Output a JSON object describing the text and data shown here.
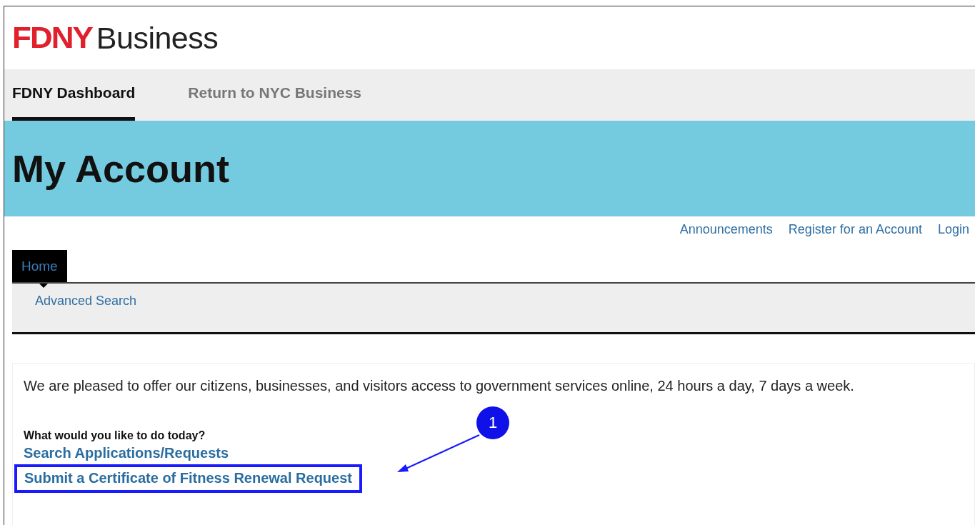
{
  "logo": {
    "mark": "FDNY",
    "word": "Business"
  },
  "nav_tabs": [
    {
      "label": "FDNY Dashboard",
      "selected": true
    },
    {
      "label": "Return to NYC Business",
      "selected": false
    }
  ],
  "banner": {
    "title": "My Account"
  },
  "utility_links": [
    "Announcements",
    "Register for an Account",
    "Login"
  ],
  "menu_tabs": [
    {
      "label": "Home",
      "selected": true
    }
  ],
  "sub_menu": [
    "Advanced Search"
  ],
  "content": {
    "intro": "We are pleased to offer our citizens, businesses, and visitors access to government services online, 24 hours a day, 7 days a week.",
    "question": "What would you like to do today?",
    "actions": [
      {
        "label": "Search Applications/Requests",
        "highlighted": false
      },
      {
        "label": "Submit a Certificate of Fitness Renewal Request",
        "highlighted": true
      }
    ]
  },
  "callout": {
    "number": "1"
  }
}
